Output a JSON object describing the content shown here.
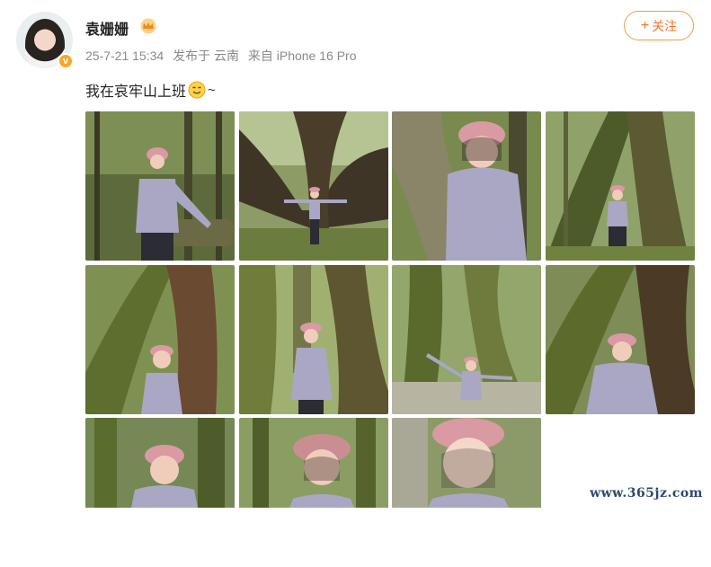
{
  "header": {
    "username": "袁姗姗",
    "verified_badge_color": "#f8a62b",
    "follow_label": "+关注",
    "follow_plus": "+",
    "follow_text": "关注"
  },
  "meta": {
    "date": "25-7-21 15:34",
    "location": "发布于 云南",
    "source": "来自 iPhone 16 Pro"
  },
  "post": {
    "text": "我在哀牢山上班",
    "emoji": "smile-emoji-icon",
    "suffix": "~"
  },
  "photos": [
    {
      "id": 1,
      "scene": "forest-log-pose"
    },
    {
      "id": 2,
      "scene": "arms-out-giant-tree"
    },
    {
      "id": 3,
      "scene": "closeup-by-trunk"
    },
    {
      "id": 4,
      "scene": "hands-together-between-trunks"
    },
    {
      "id": 5,
      "scene": "mossy-trunk-pose"
    },
    {
      "id": 6,
      "scene": "standing-between-trunks"
    },
    {
      "id": 7,
      "scene": "arms-out-mossy-tree"
    },
    {
      "id": 8,
      "scene": "seated-mossy-tree"
    },
    {
      "id": 9,
      "scene": "portrait-pink-hat"
    },
    {
      "id": 10,
      "scene": "portrait-pink-hat-tilt"
    },
    {
      "id": 11,
      "scene": "selfie-closeup"
    }
  ],
  "watermark": "www.365jz.com",
  "colors": {
    "follow_accent": "#f1762b",
    "meta_gray": "#8a8a8a"
  }
}
